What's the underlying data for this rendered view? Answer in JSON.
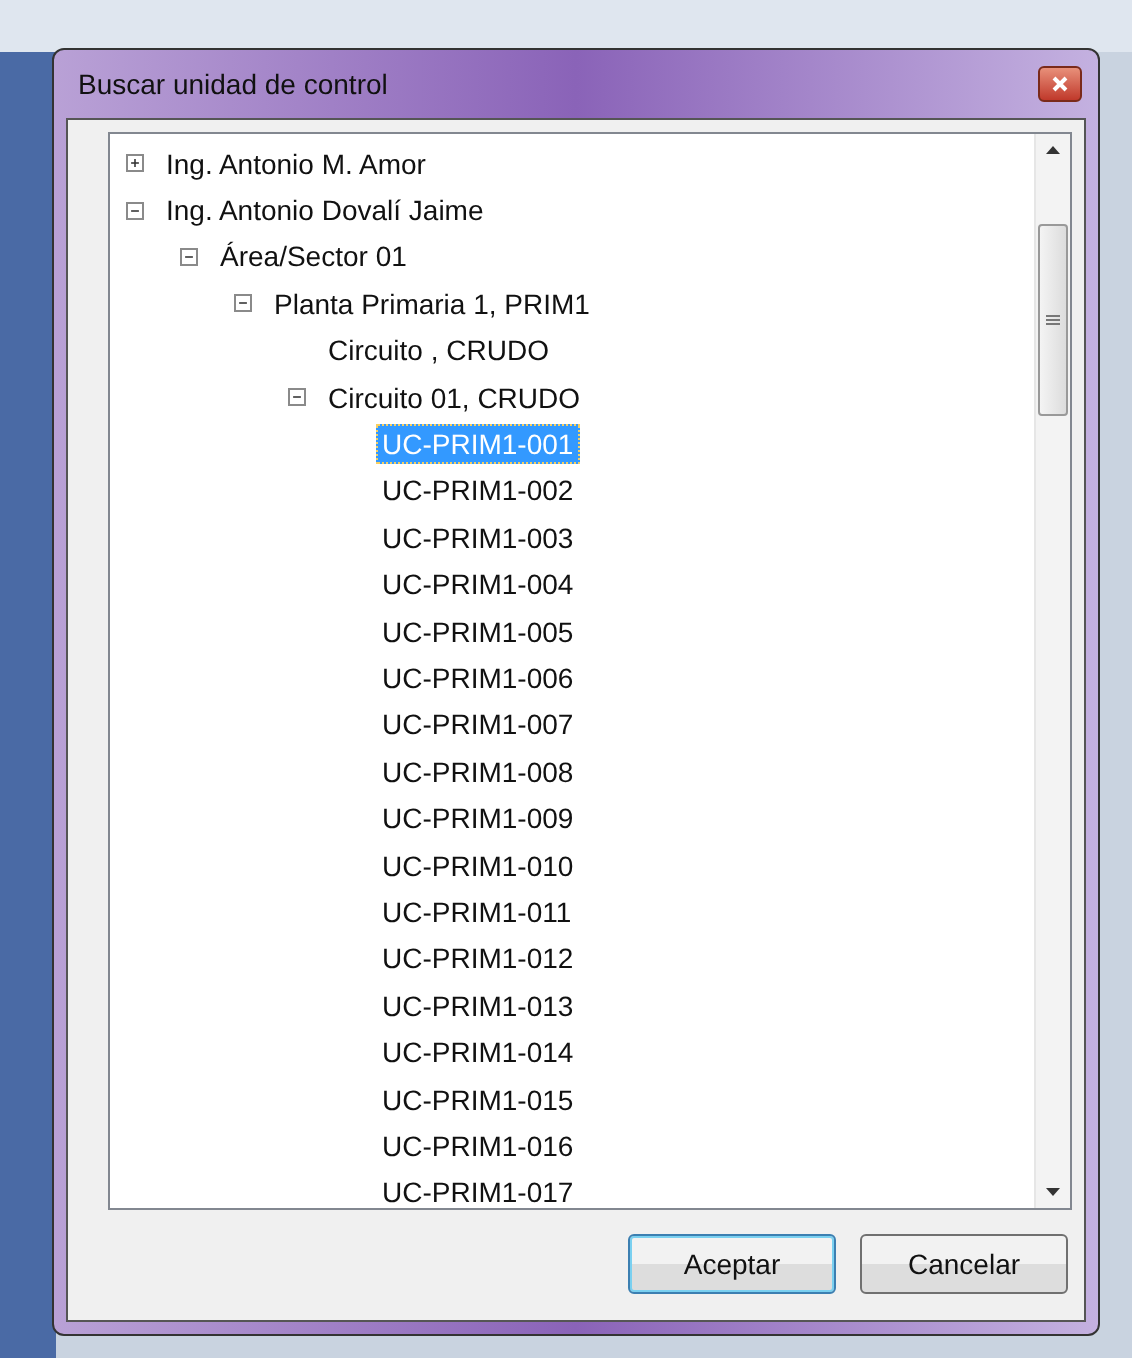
{
  "window": {
    "title": "Buscar unidad de control"
  },
  "tree": [
    {
      "label": "Ing. Antonio M. Amor",
      "expanded": false,
      "selected": false
    },
    {
      "label": "Ing. Antonio Dovalí Jaime",
      "expanded": true,
      "selected": false,
      "children": [
        {
          "label": "Área/Sector 01",
          "expanded": true,
          "selected": false,
          "children": [
            {
              "label": "Planta Primaria 1, PRIM1",
              "expanded": true,
              "selected": false,
              "children": [
                {
                  "label": "Circuito , CRUDO",
                  "selected": false
                },
                {
                  "label": "Circuito 01, CRUDO",
                  "expanded": true,
                  "selected": false,
                  "children": [
                    {
                      "label": "UC-PRIM1-001",
                      "selected": true
                    },
                    {
                      "label": "UC-PRIM1-002",
                      "selected": false
                    },
                    {
                      "label": "UC-PRIM1-003",
                      "selected": false
                    },
                    {
                      "label": "UC-PRIM1-004",
                      "selected": false
                    },
                    {
                      "label": "UC-PRIM1-005",
                      "selected": false
                    },
                    {
                      "label": "UC-PRIM1-006",
                      "selected": false
                    },
                    {
                      "label": "UC-PRIM1-007",
                      "selected": false
                    },
                    {
                      "label": "UC-PRIM1-008",
                      "selected": false
                    },
                    {
                      "label": "UC-PRIM1-009",
                      "selected": false
                    },
                    {
                      "label": "UC-PRIM1-010",
                      "selected": false
                    },
                    {
                      "label": "UC-PRIM1-011",
                      "selected": false
                    },
                    {
                      "label": "UC-PRIM1-012",
                      "selected": false
                    },
                    {
                      "label": "UC-PRIM1-013",
                      "selected": false
                    },
                    {
                      "label": "UC-PRIM1-014",
                      "selected": false
                    },
                    {
                      "label": "UC-PRIM1-015",
                      "selected": false
                    },
                    {
                      "label": "UC-PRIM1-016",
                      "selected": false
                    },
                    {
                      "label": "UC-PRIM1-017",
                      "selected": false
                    }
                  ]
                }
              ]
            }
          ]
        }
      ]
    }
  ],
  "buttons": [
    {
      "label": "Aceptar",
      "kind": "default"
    },
    {
      "label": "Cancelar",
      "kind": "normal"
    }
  ]
}
